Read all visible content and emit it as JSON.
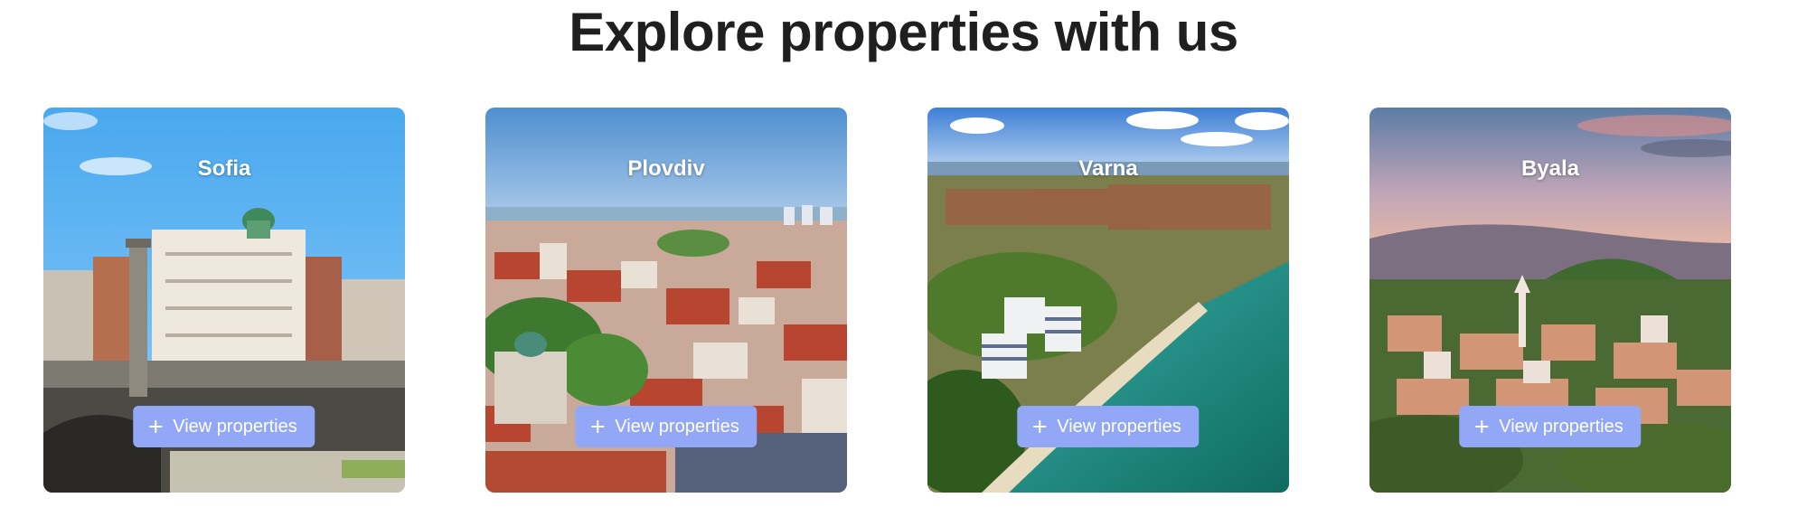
{
  "header": {
    "title": "Explore properties with us"
  },
  "theme": {
    "button_color": "#92a8f7",
    "title_color": "#1f1f1f"
  },
  "cards": [
    {
      "city": "Sofia",
      "button_label": "View properties",
      "button_icon": "plus-icon"
    },
    {
      "city": "Plovdiv",
      "button_label": "View properties",
      "button_icon": "plus-icon"
    },
    {
      "city": "Varna",
      "button_label": "View properties",
      "button_icon": "plus-icon"
    },
    {
      "city": "Byala",
      "button_label": "View properties",
      "button_icon": "plus-icon"
    }
  ]
}
